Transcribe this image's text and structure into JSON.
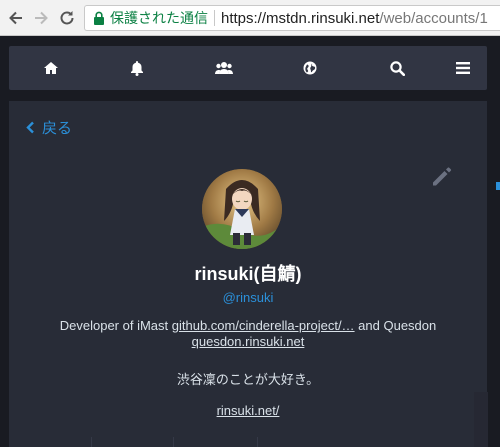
{
  "browser": {
    "secure_label": "保護された通信",
    "url_host": "https://mstdn.rinsuki.net",
    "url_path": "/web/accounts/1",
    "icons": [
      "back-arrow-icon",
      "forward-arrow-icon",
      "reload-icon",
      "lock-icon"
    ]
  },
  "app_nav": {
    "icons": [
      "home-icon",
      "bell-icon",
      "users-icon",
      "globe-icon",
      "search-icon",
      "menu-icon"
    ]
  },
  "profile": {
    "back_label": "戻る",
    "display_name": "rinsuki(自鯖)",
    "handle": "@rinsuki",
    "bio_prefix": "Developer of iMast ",
    "bio_link_github": "github.com/cinderella-project/…",
    "bio_middle": " and Quesdon",
    "bio_link_quesdon": "quesdon.rinsuki.net",
    "bio_jp": "渋谷凜のことが大好き。",
    "website_link": "rinsuki.net/"
  },
  "colors": {
    "accent": "#2b90d9",
    "background": "#191b22",
    "panel": "#282c37",
    "topbar": "#313543",
    "secure_green": "#0b8043"
  }
}
